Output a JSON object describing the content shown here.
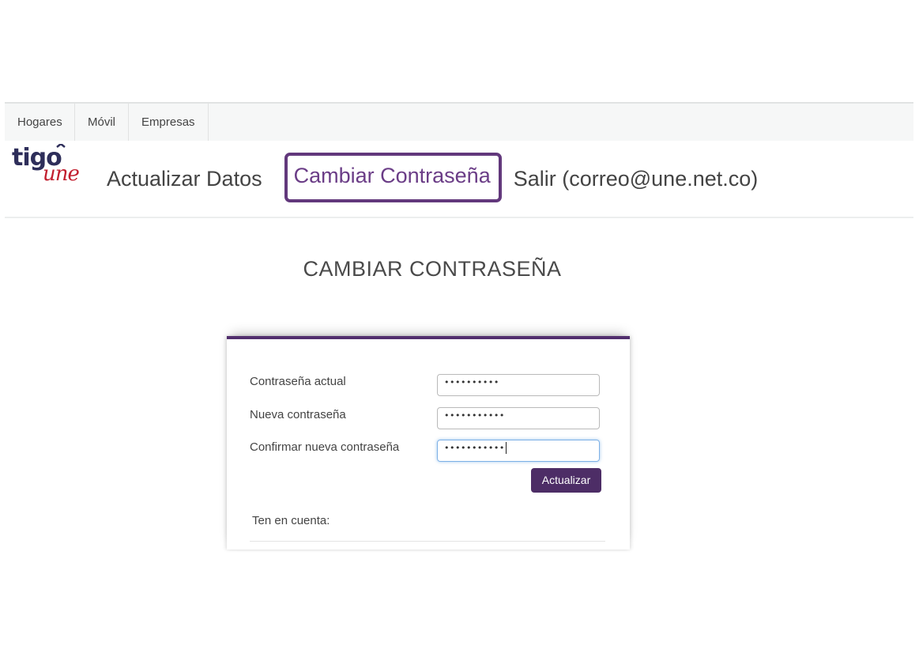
{
  "topbar": {
    "tabs": [
      {
        "label": "Hogares"
      },
      {
        "label": "Móvil"
      },
      {
        "label": "Empresas"
      }
    ]
  },
  "brand": {
    "logo_text_top": "tigo",
    "logo_text_bottom": "une",
    "color_primary": "#4d2d66",
    "color_logo_red": "#c21f2f"
  },
  "nav": {
    "actualizar": "Actualizar Datos",
    "cambiar": "Cambiar Contraseña",
    "salir": "Salir (correo@une.net.co)"
  },
  "page_title": "CAMBIAR CONTRASEÑA",
  "form": {
    "fields": [
      {
        "label": "Contraseña actual",
        "value": "••••••••••"
      },
      {
        "label": "Nueva contraseña",
        "value": "•••••••••••"
      },
      {
        "label": "Confirmar nueva contraseña",
        "value": "•••••••••••"
      }
    ],
    "submit_label": "Actualizar",
    "note_label": "Ten en cuenta:"
  }
}
